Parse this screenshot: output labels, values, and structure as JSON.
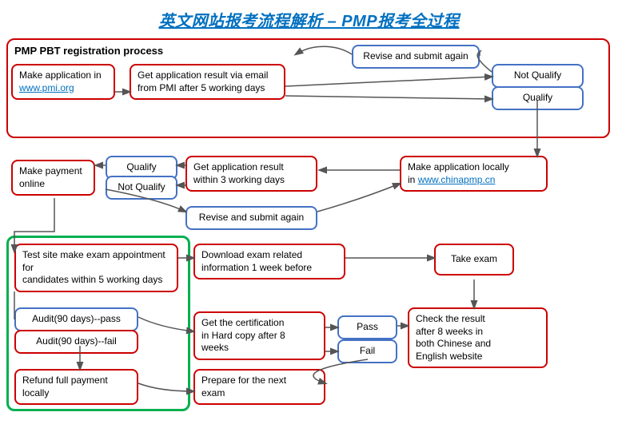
{
  "title": "英文网站报考流程解析 – PMP报考全过程",
  "boxes": {
    "pbt_header": "PMP PBT registration process",
    "make_application": "Make application in\nwww.pmi.org",
    "get_result_email": "Get application result via email\nfrom PMI after 5 working days",
    "revise_submit": "Revise and submit again",
    "not_qualify_top": "Not Qualify",
    "qualify_top": "Qualify",
    "make_payment": "Make payment\nonline",
    "qualify_mid": "Qualify",
    "not_qualify_mid": "Not Qualify",
    "get_result_3days": "Get application result\nwithin 3 working days",
    "make_app_locally": "Make application locally\nin www.chinapmp.cn",
    "revise_submit2": "Revise and submit again",
    "test_site": "Test site make exam appointment for\ncandidates within 5 working days",
    "download_exam": "Download exam related\ninformation 1 week before",
    "take_exam": "Take exam",
    "audit_pass": "Audit(90 days)--pass",
    "audit_fail": "Audit(90 days)--fail",
    "refund": "Refund full payment\nlocally",
    "certification": "Get the certification\nin Hard copy after 8\nweeks",
    "prepare_next": "Prepare for the next\nexam",
    "pass": "Pass",
    "fail": "Fail",
    "check_result": "Check the result\nafter 8 weeks in\nboth Chinese and\nEnglish website"
  }
}
